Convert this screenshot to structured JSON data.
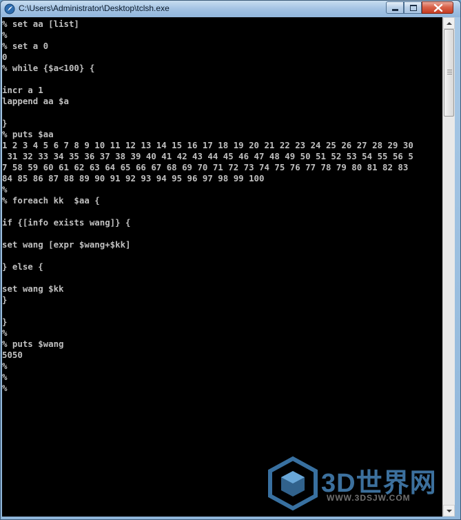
{
  "window": {
    "title": "C:\\Users\\Administrator\\Desktop\\tclsh.exe"
  },
  "console": {
    "lines": [
      "% set aa [list]",
      "%",
      "% set a 0",
      "0",
      "% while {$a<100} {",
      "",
      "incr a 1",
      "lappend aa $a",
      "",
      "}",
      "% puts $aa",
      "1 2 3 4 5 6 7 8 9 10 11 12 13 14 15 16 17 18 19 20 21 22 23 24 25 26 27 28 29 30",
      " 31 32 33 34 35 36 37 38 39 40 41 42 43 44 45 46 47 48 49 50 51 52 53 54 55 56 5",
      "7 58 59 60 61 62 63 64 65 66 67 68 69 70 71 72 73 74 75 76 77 78 79 80 81 82 83",
      "84 85 86 87 88 89 90 91 92 93 94 95 96 97 98 99 100",
      "%",
      "% foreach kk  $aa {",
      "",
      "if {[info exists wang]} {",
      "",
      "set wang [expr $wang+$kk]",
      "",
      "} else {",
      "",
      "set wang $kk",
      "}",
      "",
      "}",
      "%",
      "% puts $wang",
      "5050",
      "%",
      "%",
      "%"
    ]
  },
  "watermark": {
    "text": "3D世界网",
    "url": "WWW.3DSJW.COM"
  },
  "icons": {
    "app": "tcl-feather-icon",
    "minimize": "minimize-icon",
    "maximize": "maximize-icon",
    "close": "close-icon",
    "scroll_up": "arrow-up-icon",
    "scroll_down": "arrow-down-icon"
  },
  "colors": {
    "console_bg": "#000000",
    "console_fg": "#c0c0c0",
    "close_button": "#c43c22"
  }
}
